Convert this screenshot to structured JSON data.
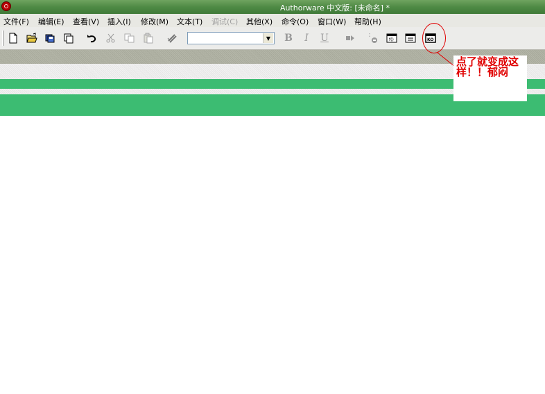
{
  "window": {
    "title": "Authorware 中文版: [未命名] *"
  },
  "menu": {
    "items": [
      {
        "label": "文件(F)",
        "enabled": true
      },
      {
        "label": "编辑(E)",
        "enabled": true
      },
      {
        "label": "查看(V)",
        "enabled": true
      },
      {
        "label": "插入(I)",
        "enabled": true
      },
      {
        "label": "修改(M)",
        "enabled": true
      },
      {
        "label": "文本(T)",
        "enabled": true
      },
      {
        "label": "调试(C)",
        "enabled": false
      },
      {
        "label": "其他(X)",
        "enabled": true
      },
      {
        "label": "命令(O)",
        "enabled": true
      },
      {
        "label": "窗口(W)",
        "enabled": true
      },
      {
        "label": "帮助(H)",
        "enabled": true
      }
    ]
  },
  "toolbar": {
    "font_select_value": "",
    "format": {
      "bold": "B",
      "italic": "I",
      "underline": "U"
    },
    "icons": [
      "new-file-icon",
      "open-folder-icon",
      "save-all-icon",
      "import-icon",
      "undo-icon",
      "cut-icon",
      "copy-icon",
      "paste-icon",
      "find-icon",
      "font-dropdown",
      "bold-icon",
      "italic-icon",
      "underline-icon",
      "run-icon",
      "control-panel-icon",
      "functions-icon",
      "variables-icon",
      "knowledge-object-icon"
    ]
  },
  "annotation": {
    "text": "点了就变成这样！！郁闷",
    "color": "#e00000"
  },
  "colors": {
    "titlebar": "#4f8a45",
    "accent_green": "#3cbc72",
    "menubar": "#e8e8e3"
  }
}
